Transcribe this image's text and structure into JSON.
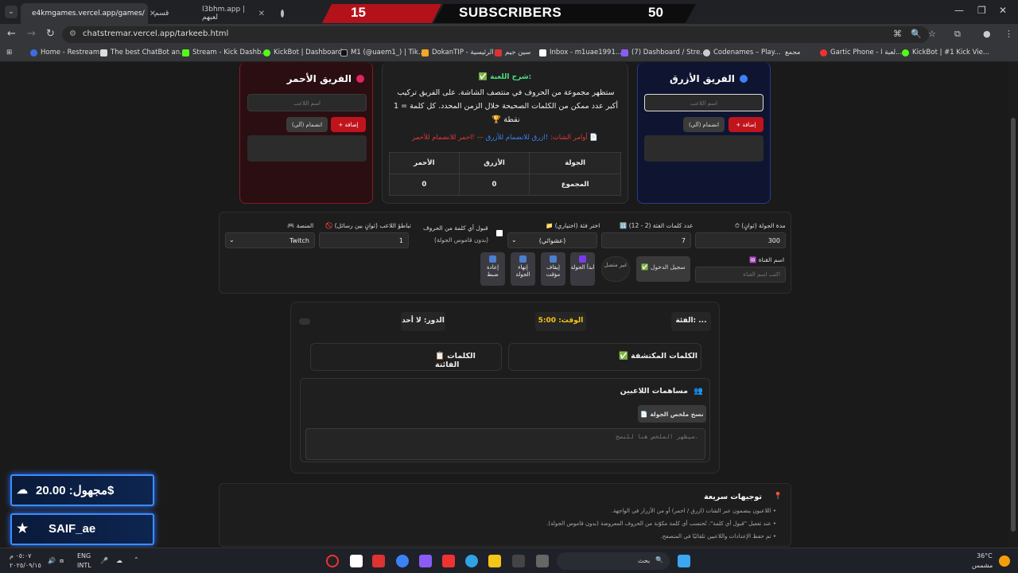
{
  "browser": {
    "tabs": [
      "e4kmgames.vercel.app/games/",
      "قسم",
      "l3bhm.app | لعبهم"
    ],
    "url": "chatstremar.vercel.app/tarkeeb.html",
    "bookmarks": [
      "Home - Restream",
      "The best ChatBot an...",
      "Stream - Kick Dashb...",
      "KickBot | Dashboard",
      "M1 (@uaem1_) | Tik...",
      "DokanTIP - الرئيسية",
      "سين جيم",
      "Inbox - m1uae1991...",
      "(7) Dashboard / Stre...",
      "Codenames – Play...",
      "مجمع",
      "Gartic Phone - لعبة ا...",
      "KickBot | #1 Kick Vie..."
    ]
  },
  "overlay": {
    "left_count": "15",
    "title": "SUBSCRIBERS",
    "right_count": "50"
  },
  "teams": {
    "red": {
      "title": "الفريق الأحمر",
      "placeholder": "اسم اللاعب",
      "add": "+ إضافة",
      "join": "انضمام (آلي)"
    },
    "blue": {
      "title": "الفريق الأزرق",
      "placeholder": "اسم اللاعب",
      "add": "+ إضافة",
      "join": "انضمام (آلي)"
    }
  },
  "explain": {
    "heading": "✅ شرح اللعبة:",
    "body": "ستظهر مجموعة من الحروف في منتصف الشاشة. على الفريق تركيب أكبر عدد ممكن من الكلمات الصحيحة خلال الزمن المحدد. كل كلمة = 1 نقطة 🏆",
    "commands_prefix": "📄 أوامر الشات:",
    "cmd_blue": "!ازرق للانضمام للأزرق",
    "cmd_sep": " — ",
    "cmd_red": "!احمر للانضمام للأحمر"
  },
  "score": {
    "headers": [
      "الجولة",
      "الأزرق",
      "الأحمر"
    ],
    "row_label": "المجموع",
    "blue": "0",
    "red": "0"
  },
  "settings": {
    "round_duration_label": "⏱ مدة الجولة (ثوانٍ)",
    "round_duration": "300",
    "category_words_label": "🔢 عدد كلمات الفئة (2 - 12)",
    "category_words": "7",
    "category_label": "📁 اختر فئة (اختياري)",
    "category_value": "(عشوائي)",
    "accept_any_label": "قبول أي كلمة من الحروف",
    "accept_any_sub": "(بدون قاموس الجولة)",
    "cooldown_label": "🚫 تباطؤ اللاعب (ثوانٍ بين رسائل)",
    "cooldown": "1",
    "platform_label": "🎮 المنصة",
    "platform": "Twitch",
    "channel_label": "🆔 اسم القناة",
    "channel_placeholder": "اكتب اسم القناة",
    "login": "✅ سجيل الدخول",
    "status": "غير متصل",
    "buttons": [
      "ابدأ الجولة",
      "إيقاف مؤقت",
      "إنهاء الجولة",
      "إعادة ضبط"
    ]
  },
  "game": {
    "category": "الفئة: ...",
    "time": "الوقت: 5:00",
    "turn": "الدور: لا أحد",
    "found": "✅ الكلمات المكتشفة",
    "missed": "📋 الكلمات الفائتة",
    "contrib_title": "مساهمات اللاعبين",
    "copy_summary": "📄 نسخ ملخص الجولة",
    "summary_placeholder": "سيظهر الملخص هنا للنسخ."
  },
  "tips": {
    "title": "توجيهات سريعة",
    "items": [
      "• اللاعبون ينضمون عبر الشات (ازرق / احمر) أو من الأزرار في الواجهة.",
      "• عند تفعيل \"قبول أي كلمة\"، تُحتسب أي كلمة مكوّنة من الحروف المعروضة (بدون قاموس الجولة).",
      "• تم حفظ الإعدادات واللاعبين تلقائيًا في المتصفح."
    ]
  },
  "widgets": {
    "donation": "مجهول: 20.00$",
    "user": "SAIF_ae"
  },
  "taskbar": {
    "time": "٠٥:٠٧ م",
    "date": "٢٠٢٥/٠٩/١٥",
    "lang1": "ENG",
    "lang2": "INTL",
    "search": "بحث",
    "temp": "36°C",
    "weather": "مشمس"
  },
  "colors": {
    "red_accent": "#c0141c",
    "blue_accent": "#3b82f6",
    "green": "#4ade80",
    "gold": "#f5c518"
  }
}
